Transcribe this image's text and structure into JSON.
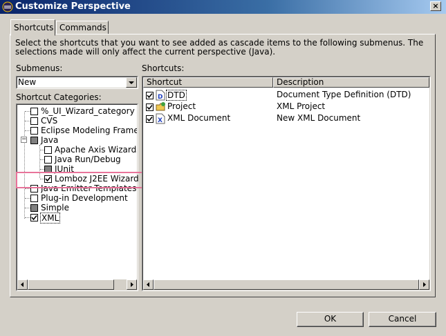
{
  "window": {
    "title": "Customize Perspective",
    "close_glyph": "×",
    "icon": "eclipse-icon"
  },
  "tabs": [
    {
      "label": "Shortcuts"
    },
    {
      "label": "Commands"
    }
  ],
  "description": {
    "line1": "Select the shortcuts that you want to see added as cascade items to the following submenus.  The",
    "line2": "selections made will only affect the current perspective (Java)."
  },
  "submenus": {
    "label": "Submenus:",
    "selected": "New"
  },
  "categories": {
    "label": "Shortcut Categories:",
    "items": [
      {
        "label": "%_UI_Wizard_category",
        "state": "unchecked"
      },
      {
        "label": "CVS",
        "state": "unchecked"
      },
      {
        "label": "Eclipse Modeling Frame",
        "state": "unchecked"
      },
      {
        "label": "Java",
        "state": "grayed",
        "expander": "−"
      },
      {
        "label": "Apache Axis Wizards",
        "state": "unchecked"
      },
      {
        "label": "Java Run/Debug",
        "state": "unchecked"
      },
      {
        "label": "JUnit",
        "state": "grayed"
      },
      {
        "label": "Lomboz J2EE Wizard",
        "state": "checked"
      },
      {
        "label": "Java Emitter Templates",
        "state": "unchecked"
      },
      {
        "label": "Plug-in Development",
        "state": "unchecked"
      },
      {
        "label": "Simple",
        "state": "grayed"
      },
      {
        "label": "XML",
        "state": "checked"
      }
    ]
  },
  "shortcuts": {
    "label": "Shortcuts:",
    "columns": [
      "Shortcut",
      "Description"
    ],
    "rows": [
      {
        "shortcut": "DTD",
        "description": "Document Type Definition (DTD)",
        "icon": "dtd-file-icon"
      },
      {
        "shortcut": "Project",
        "description": "XML Project",
        "icon": "project-folder-icon"
      },
      {
        "shortcut": "XML Document",
        "description": "New XML Document",
        "icon": "xml-file-icon"
      }
    ]
  },
  "buttons": {
    "ok": "OK",
    "cancel": "Cancel"
  },
  "colors": {
    "highlight": "#e8739a",
    "titlebar": "#0a246a"
  }
}
